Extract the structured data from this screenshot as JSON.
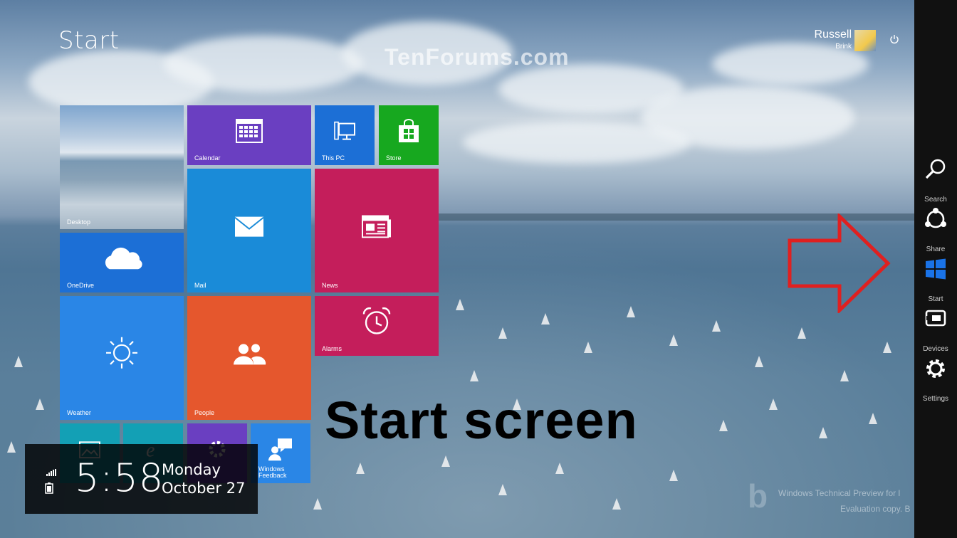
{
  "screen": {
    "title": "Start",
    "watermark": "TenForums.com",
    "caption": "Start screen"
  },
  "user": {
    "name": "Russell",
    "sub": "Brink"
  },
  "tiles": {
    "desktop": "Desktop",
    "calendar": "Calendar",
    "this_pc": "This PC",
    "store": "Store",
    "onedrive": "OneDrive",
    "mail": "Mail",
    "news": "News",
    "weather": "Weather",
    "people": "People",
    "alarms": "Alarms",
    "feedback": "Windows Feedback"
  },
  "clock": {
    "time": "5:58",
    "day": "Monday",
    "date": "October 27"
  },
  "charms": [
    {
      "label": "Search",
      "icon": "search-icon"
    },
    {
      "label": "Share",
      "icon": "share-icon"
    },
    {
      "label": "Start",
      "icon": "windows-logo-icon"
    },
    {
      "label": "Devices",
      "icon": "devices-icon"
    },
    {
      "label": "Settings",
      "icon": "gear-icon"
    }
  ],
  "bing": {
    "line1": "Windows Technical Preview for l",
    "line2": "Evaluation copy. B"
  },
  "colors": {
    "calendar": "#6a3fc1",
    "this_pc": "#1c6fd6",
    "store": "#17a81f",
    "onedrive": "#1c6fd6",
    "mail": "#1a8bd8",
    "news": "#c41e5b",
    "weather": "#2a86e6",
    "people": "#e5572d",
    "alarms": "#c41e5b",
    "arrow": "#e02020",
    "charm_start": "#1a73e8"
  }
}
